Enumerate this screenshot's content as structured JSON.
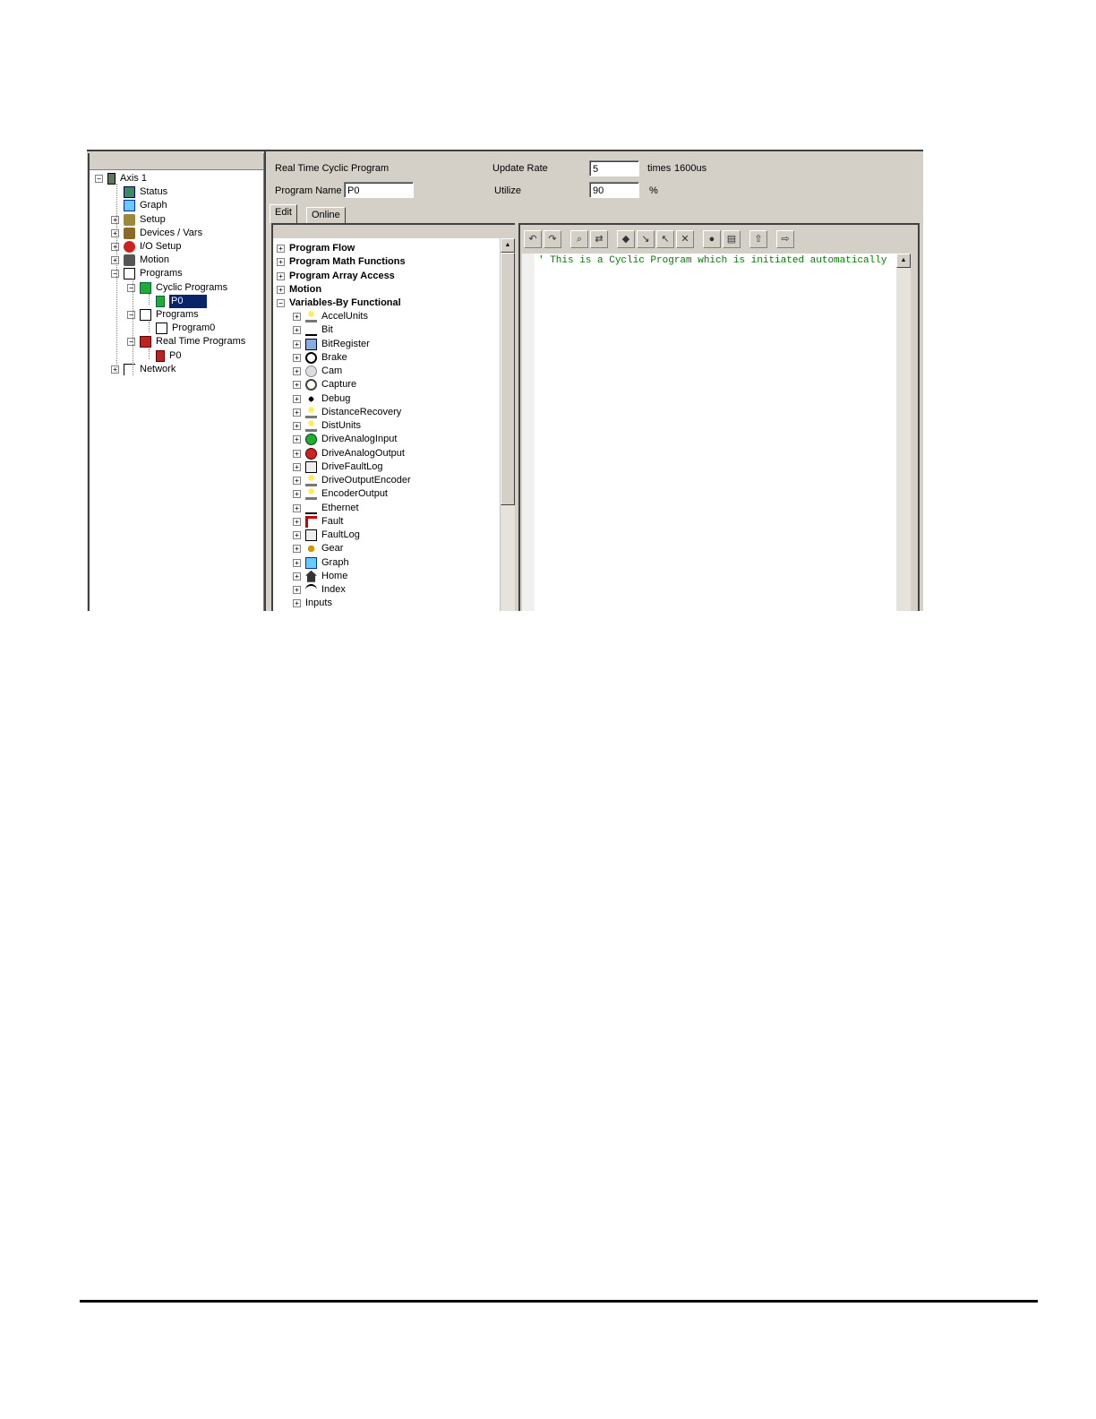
{
  "project_tree": {
    "items": [
      {
        "label": "Axis 1",
        "expander": "−",
        "icon": "drive-icon"
      },
      {
        "label": "Status",
        "expander": "",
        "icon": "status-monitor-icon"
      },
      {
        "label": "Graph",
        "expander": "",
        "icon": "graph-icon"
      },
      {
        "label": "Setup",
        "expander": "+",
        "icon": "setup-icon"
      },
      {
        "label": "Devices / Vars",
        "expander": "+",
        "icon": "devices-icon"
      },
      {
        "label": "I/O Setup",
        "expander": "+",
        "icon": "io-icon"
      },
      {
        "label": "Motion",
        "expander": "+",
        "icon": "motion-icon"
      },
      {
        "label": "Programs",
        "expander": "−",
        "icon": "programs-icon"
      },
      {
        "label": "Cyclic Programs",
        "expander": "−",
        "icon": "cyclic-programs-icon"
      },
      {
        "label": "P0",
        "expander": "",
        "icon": "program-green-icon",
        "selected": true
      },
      {
        "label": "Programs",
        "expander": "−",
        "icon": "programs-icon"
      },
      {
        "label": "Program0",
        "expander": "",
        "icon": "program-doc-icon"
      },
      {
        "label": "Real Time Programs",
        "expander": "−",
        "icon": "realtime-programs-icon"
      },
      {
        "label": "P0",
        "expander": "",
        "icon": "program-red-icon"
      },
      {
        "label": "Network",
        "expander": "+",
        "icon": "network-icon"
      }
    ]
  },
  "header": {
    "program_type": "Real Time Cyclic Program",
    "program_name_label": "Program Name",
    "program_name_value": "P0",
    "update_rate_label": "Update Rate",
    "update_rate_value": "5",
    "update_rate_suffix": "times",
    "update_rate_time": "1600us",
    "utilize_label": "Utilize",
    "utilize_value": "90",
    "utilize_suffix": "%"
  },
  "tabs": [
    {
      "label": "Edit"
    },
    {
      "label": "Online"
    }
  ],
  "variables_tree": {
    "categories": [
      {
        "label": "Program Flow",
        "expander": "+"
      },
      {
        "label": "Program Math Functions",
        "expander": "+"
      },
      {
        "label": "Program Array Access",
        "expander": "+"
      },
      {
        "label": "Motion",
        "expander": "+"
      },
      {
        "label": "Variables-By Functional",
        "expander": "−"
      }
    ],
    "items": [
      {
        "label": "AccelUnits",
        "icon": "bulb-icon"
      },
      {
        "label": "Bit",
        "icon": "user-bit-icon"
      },
      {
        "label": "BitRegister",
        "icon": "user-register-icon"
      },
      {
        "label": "Brake",
        "icon": "brake-icon"
      },
      {
        "label": "Cam",
        "icon": "cam-icon"
      },
      {
        "label": "Capture",
        "icon": "clock-icon"
      },
      {
        "label": "Debug",
        "icon": "bug-icon"
      },
      {
        "label": "DistanceRecovery",
        "icon": "bulb-icon"
      },
      {
        "label": "DistUnits",
        "icon": "bulb-icon"
      },
      {
        "label": "DriveAnalogInput",
        "icon": "analog-in-icon"
      },
      {
        "label": "DriveAnalogOutput",
        "icon": "analog-out-icon"
      },
      {
        "label": "DriveFaultLog",
        "icon": "log-book-icon"
      },
      {
        "label": "DriveOutputEncoder",
        "icon": "bulb-icon"
      },
      {
        "label": "EncoderOutput",
        "icon": "bulb-icon"
      },
      {
        "label": "Ethernet",
        "icon": "ethernet-ip-icon"
      },
      {
        "label": "Fault",
        "icon": "fault-icon"
      },
      {
        "label": "FaultLog",
        "icon": "log-book-icon"
      },
      {
        "label": "Gear",
        "icon": "gear-icon"
      },
      {
        "label": "Graph",
        "icon": "graph-icon"
      },
      {
        "label": "Home",
        "icon": "home-icon"
      },
      {
        "label": "Index",
        "icon": "index-profile-icon"
      },
      {
        "label": "Inputs",
        "icon": ""
      }
    ]
  },
  "editor": {
    "toolbar": [
      "undo-icon",
      "redo-icon",
      "find-icon",
      "find-replace-icon",
      "bookmark-icon",
      "next-bookmark-icon",
      "prev-bookmark-icon",
      "clear-bookmarks-icon",
      "breakpoint-icon",
      "compile-icon",
      "upload-icon",
      "download-icon"
    ],
    "code_lines": [
      "' This is a Cyclic Program which is initiated automatically"
    ],
    "code_color": "#008000"
  },
  "colors": {
    "window_bg": "#d4d0c8",
    "selection": "#0a246a"
  }
}
